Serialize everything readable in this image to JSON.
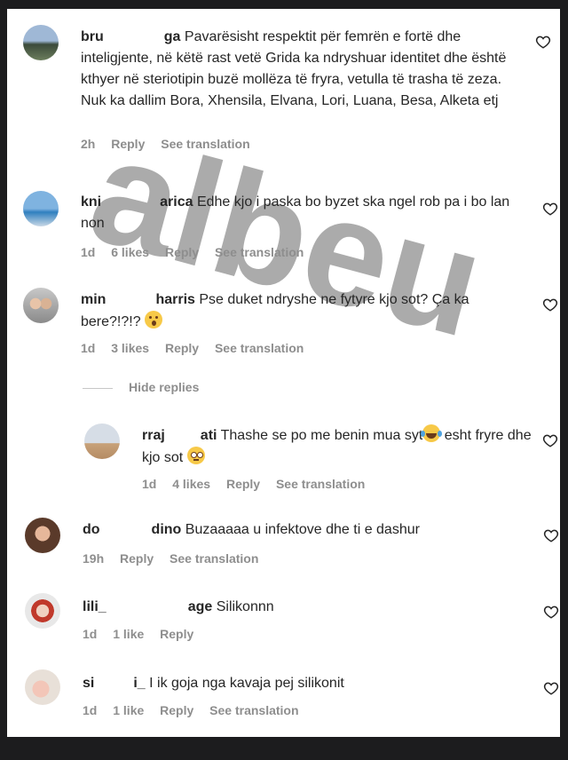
{
  "comments": [
    {
      "user": "bru",
      "user_end": "ga",
      "text": "Pavarësisht respektit për femrën e fortë dhe inteligjente, në këtë rast vetë Grida ka ndryshuar identitet dhe është kthyer në steriotipin buzë mollëza të fryra, vetulla të trasha të zeza. Nuk ka dallim Bora, Xhensila, Elvana, Lori, Luana, Besa, Alketa etj",
      "time": "2h",
      "reply": "Reply",
      "translate": "See translation"
    },
    {
      "user": "kni",
      "user_end": "arica",
      "text": "Edhe kjo i paska bo byzet ska ngel rob pa i bo lan non",
      "time": "1d",
      "likes": "6 likes",
      "reply": "Reply",
      "translate": "See translation"
    },
    {
      "user": "min",
      "user_end": "harris",
      "text": "Pse duket ndryshe ne fytyre kjo sot? Ça ka bere?!?!?",
      "time": "1d",
      "likes": "3 likes",
      "reply": "Reply",
      "translate": "See translation"
    },
    {
      "user": "rraj",
      "user_end": "ati",
      "text_a": "Thashe se po me benin mua syt",
      "text_b": "esht fryre dhe kjo sot",
      "time": "1d",
      "likes": "4 likes",
      "reply": "Reply",
      "translate": "See translation"
    },
    {
      "user": "do",
      "user_end": "dino",
      "text": "Buzaaaaa u infektove dhe ti e dashur",
      "time": "19h",
      "reply": "Reply",
      "translate": "See translation"
    },
    {
      "user": "lili_",
      "user_end": "age",
      "text": "Silikonnn",
      "time": "1d",
      "likes": "1 like",
      "reply": "Reply"
    },
    {
      "user": "si",
      "user_end": "i_",
      "text": "I ik goja nga kavaja pej silikonit",
      "time": "1d",
      "likes": "1 like",
      "reply": "Reply",
      "translate": "See translation"
    }
  ],
  "hide_replies": "Hide replies",
  "watermark": "albeu",
  "colors": {
    "text": "#262626",
    "meta": "#8e8e8e",
    "watermark": "#a0a0a0"
  }
}
